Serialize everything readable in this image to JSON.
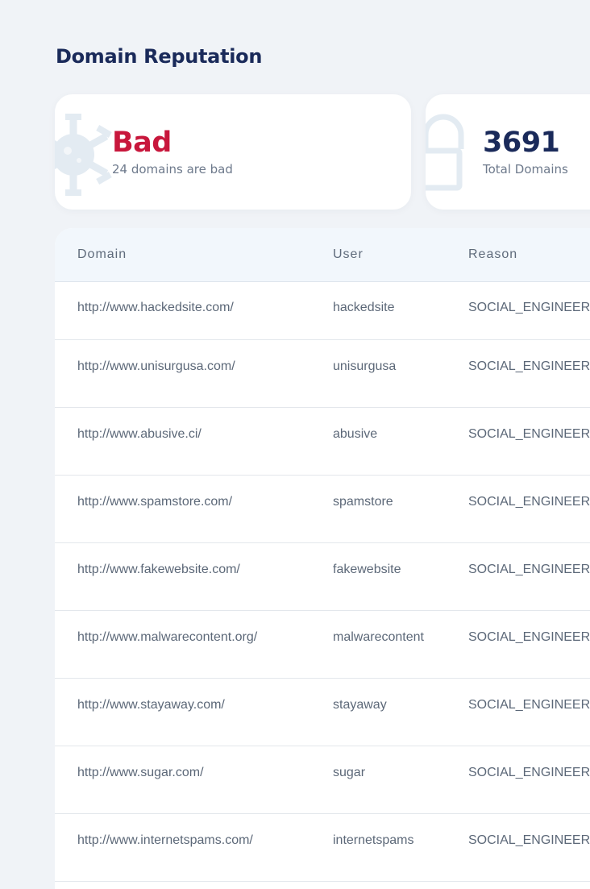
{
  "page": {
    "title": "Domain Reputation"
  },
  "cards": {
    "bad": {
      "icon": "virus-icon",
      "value": "Bad",
      "caption": "24 domains are bad",
      "color": "#c8173c"
    },
    "total": {
      "icon": "lock-icon",
      "value": "3691",
      "caption": "Total Domains",
      "color": "#1a2a5a"
    }
  },
  "table": {
    "columns": [
      "Domain",
      "User",
      "Reason"
    ],
    "rows": [
      {
        "domain": "http://www.hackedsite.com/",
        "user": "hackedsite",
        "reason": "SOCIAL_ENGINEERING"
      },
      {
        "domain": "http://www.unisurgusa.com/",
        "user": "unisurgusa",
        "reason": "SOCIAL_ENGINEERING"
      },
      {
        "domain": "http://www.abusive.ci/",
        "user": "abusive",
        "reason": "SOCIAL_ENGINEERING"
      },
      {
        "domain": "http://www.spamstore.com/",
        "user": "spamstore",
        "reason": "SOCIAL_ENGINEERING"
      },
      {
        "domain": "http://www.fakewebsite.com/",
        "user": "fakewebsite",
        "reason": "SOCIAL_ENGINEERING"
      },
      {
        "domain": "http://www.malwarecontent.org/",
        "user": "malwarecontent",
        "reason": "SOCIAL_ENGINEERING"
      },
      {
        "domain": "http://www.stayaway.com/",
        "user": "stayaway",
        "reason": "SOCIAL_ENGINEERING"
      },
      {
        "domain": "http://www.sugar.com/",
        "user": "sugar",
        "reason": "SOCIAL_ENGINEERING"
      },
      {
        "domain": "http://www.internetspams.com/",
        "user": "internetspams",
        "reason": "SOCIAL_ENGINEERING"
      }
    ]
  }
}
